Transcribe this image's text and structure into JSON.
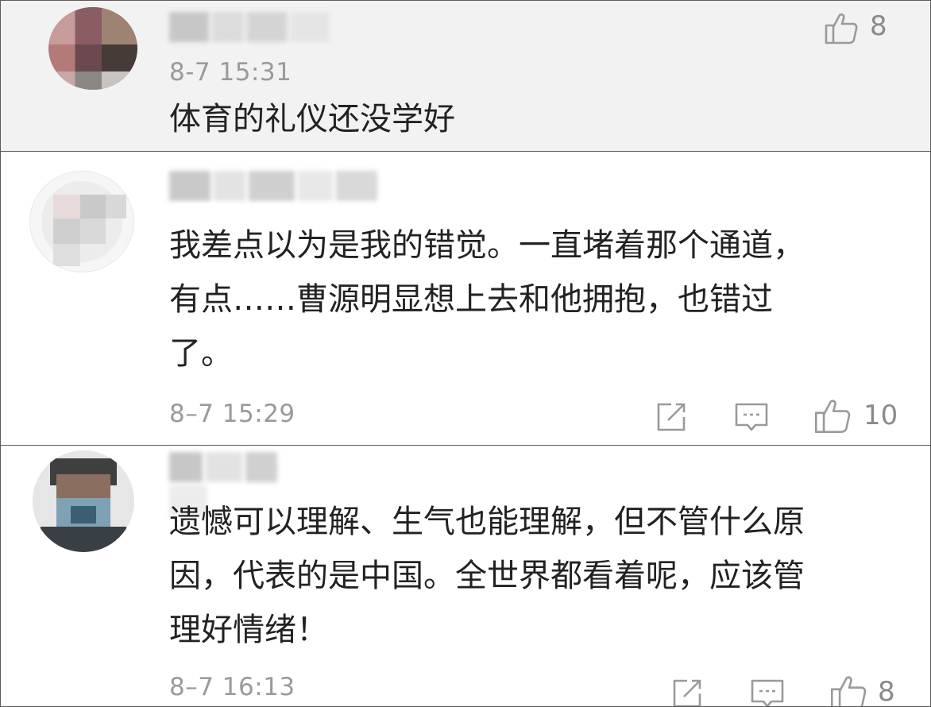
{
  "comments": [
    {
      "avatar": "user-avatar-blurred",
      "username": "",
      "time": "8-7 15:31",
      "text": "体育的礼仪还没学好",
      "likes": "8",
      "icons": [
        "thumbs-up-icon"
      ]
    },
    {
      "avatar": "user-avatar-blurred",
      "username": "",
      "time": "8–7 15:29",
      "text": "我差点以为是我的错觉。一直堵着那个通道，\n有点……曹源明显想上去和他拥抱，也错过\n了。",
      "likes": "10",
      "icons": [
        "share-icon",
        "comment-icon",
        "thumbs-up-icon"
      ]
    },
    {
      "avatar": "user-avatar-blurred",
      "username": "",
      "time": "8–7 16:13",
      "text": "遗憾可以理解、生气也能理解，但不管什么原\n因，代表的是中国。全世界都看着呢，应该管\n理好情绪！",
      "likes": "8",
      "icons": [
        "share-icon",
        "comment-icon",
        "thumbs-up-icon"
      ]
    }
  ],
  "colors": {
    "highlight_bg": "#f2f2f2",
    "meta_gray": "#9a9a9a",
    "text": "#222222",
    "border": "#5a5a5a"
  }
}
